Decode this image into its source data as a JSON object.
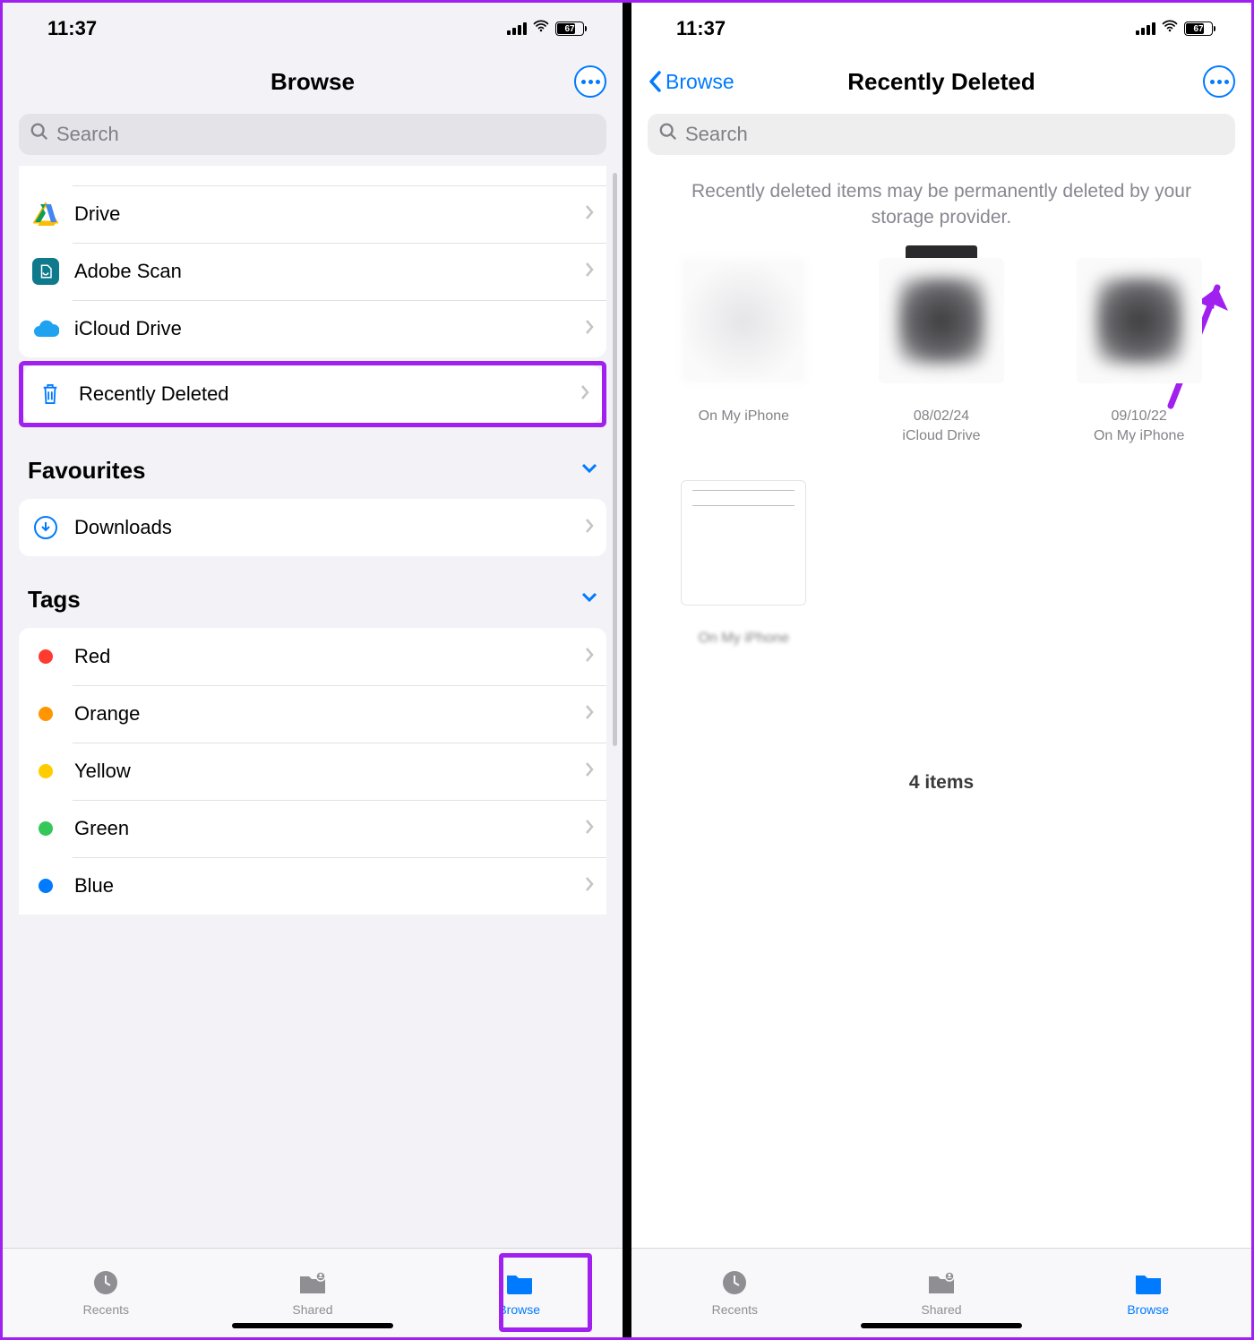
{
  "status": {
    "time": "11:37",
    "battery": "67"
  },
  "left": {
    "title": "Browse",
    "search_placeholder": "Search",
    "locations": [
      {
        "id": "drive",
        "label": "Drive"
      },
      {
        "id": "adobe",
        "label": "Adobe Scan"
      },
      {
        "id": "icloud",
        "label": "iCloud Drive"
      },
      {
        "id": "recently-deleted",
        "label": "Recently Deleted"
      }
    ],
    "favourites": {
      "header": "Favourites",
      "items": [
        {
          "id": "downloads",
          "label": "Downloads"
        }
      ]
    },
    "tags": {
      "header": "Tags",
      "items": [
        {
          "label": "Red",
          "color": "#ff3b30"
        },
        {
          "label": "Orange",
          "color": "#ff9500"
        },
        {
          "label": "Yellow",
          "color": "#ffcc00"
        },
        {
          "label": "Green",
          "color": "#34c759"
        },
        {
          "label": "Blue",
          "color": "#007aff"
        }
      ]
    }
  },
  "right": {
    "back_label": "Browse",
    "title": "Recently Deleted",
    "search_placeholder": "Search",
    "note": "Recently deleted items may be permanently deleted by your storage provider.",
    "files": [
      {
        "date": "",
        "location": "On My iPhone"
      },
      {
        "date": "08/02/24",
        "location": "iCloud Drive"
      },
      {
        "date": "09/10/22",
        "location": "On My iPhone"
      },
      {
        "date": "",
        "location": "On My iPhone"
      }
    ],
    "count_label": "4 items"
  },
  "tabs": [
    {
      "id": "recents",
      "label": "Recents"
    },
    {
      "id": "shared",
      "label": "Shared"
    },
    {
      "id": "browse",
      "label": "Browse"
    }
  ]
}
